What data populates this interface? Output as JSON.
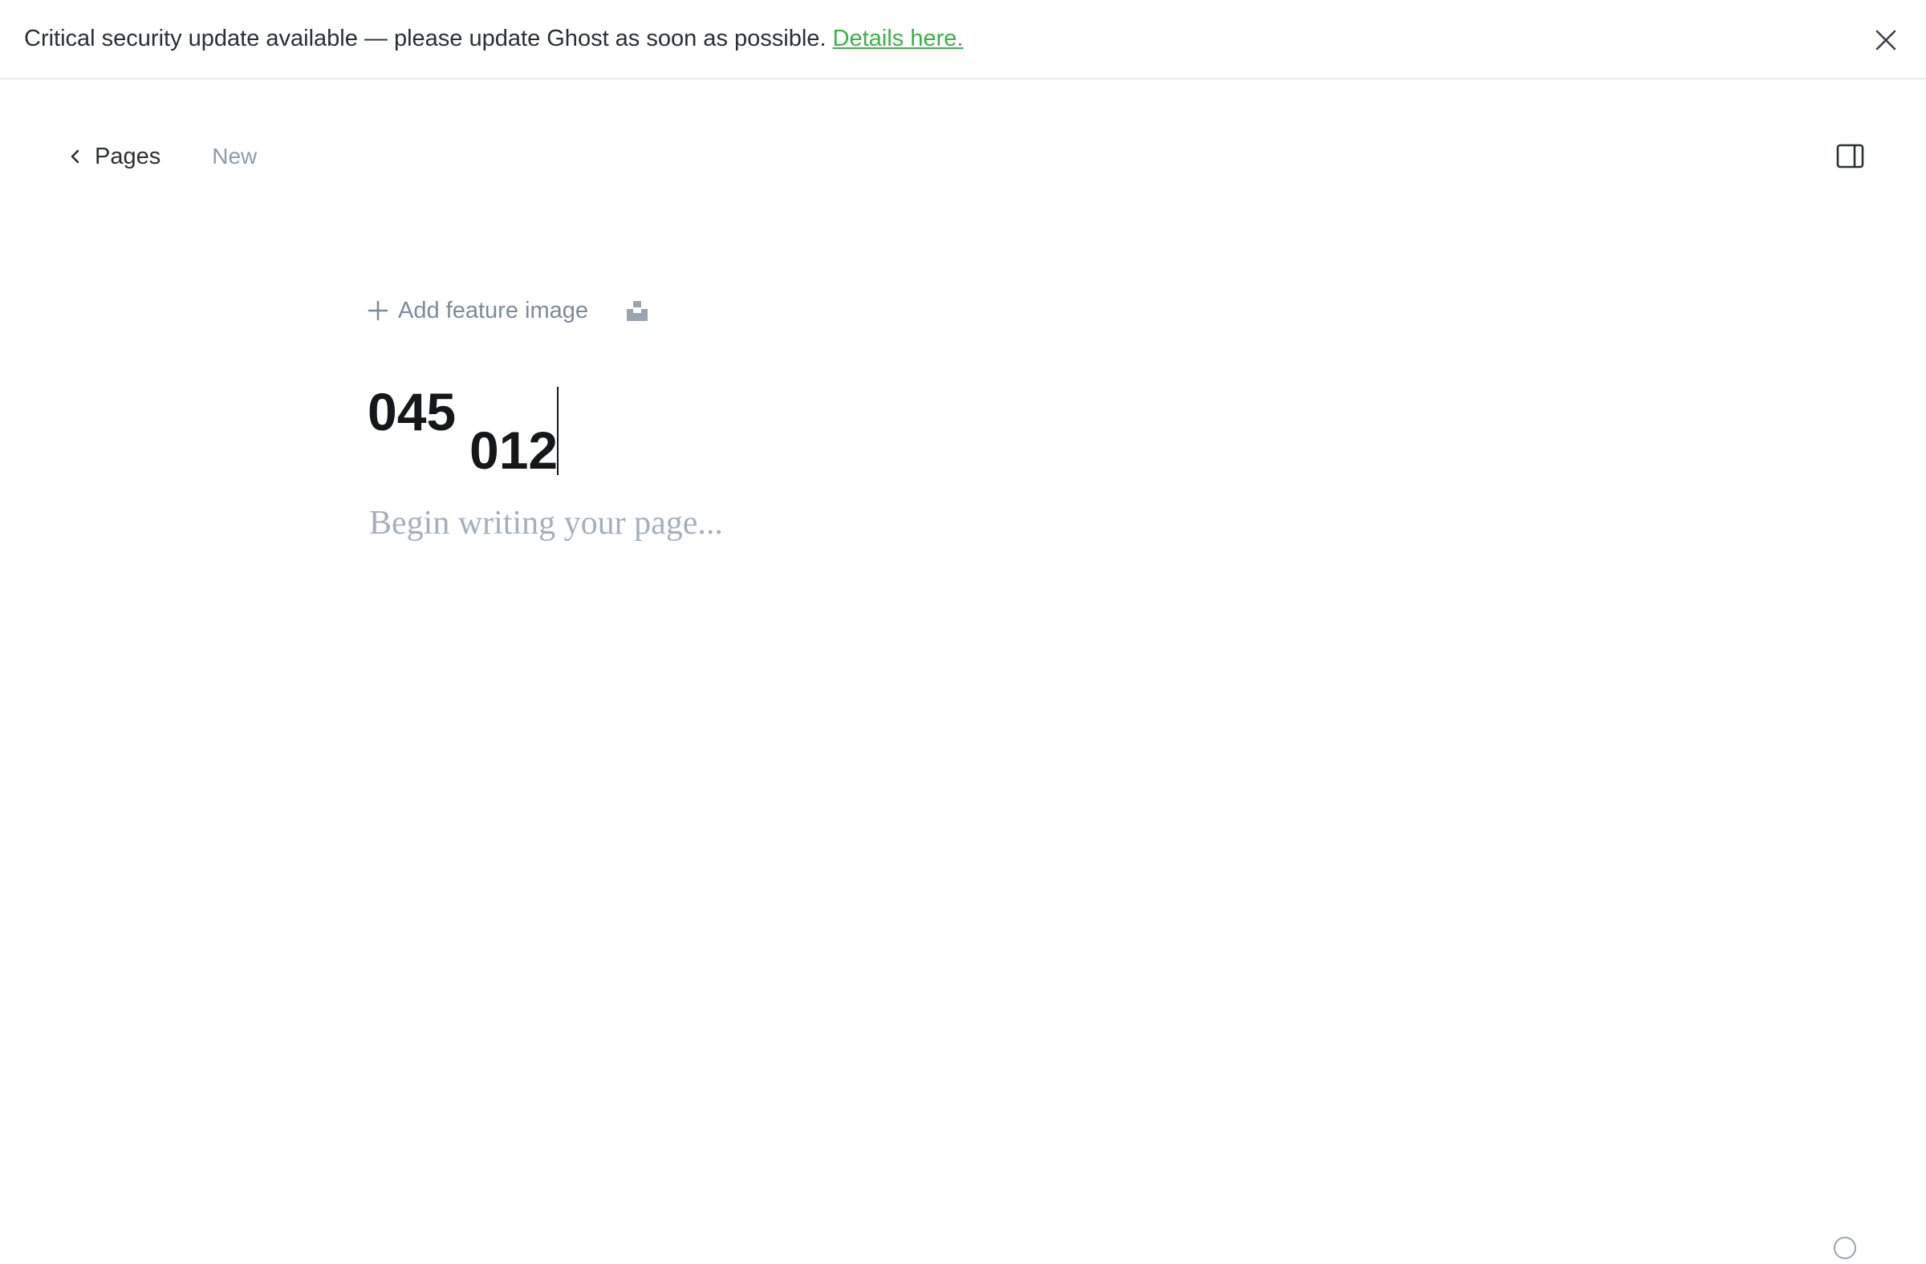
{
  "banner": {
    "message": "Critical security update available — please update Ghost as soon as possible. ",
    "link_label": "Details here.",
    "close_icon": "close-icon",
    "link_color": "#3eb049"
  },
  "nav": {
    "back_label": "Pages",
    "status": "New",
    "back_icon": "chevron-left-icon",
    "settings_icon": "sidebar-toggle-icon"
  },
  "editor": {
    "add_feature_label": "Add feature image",
    "plus_icon": "plus-icon",
    "unsplash_icon": "unsplash-icon",
    "title_line1": "045",
    "title_line2": "012",
    "body_placeholder": "Begin writing your page..."
  },
  "footer": {
    "help_icon": "help-icon"
  }
}
